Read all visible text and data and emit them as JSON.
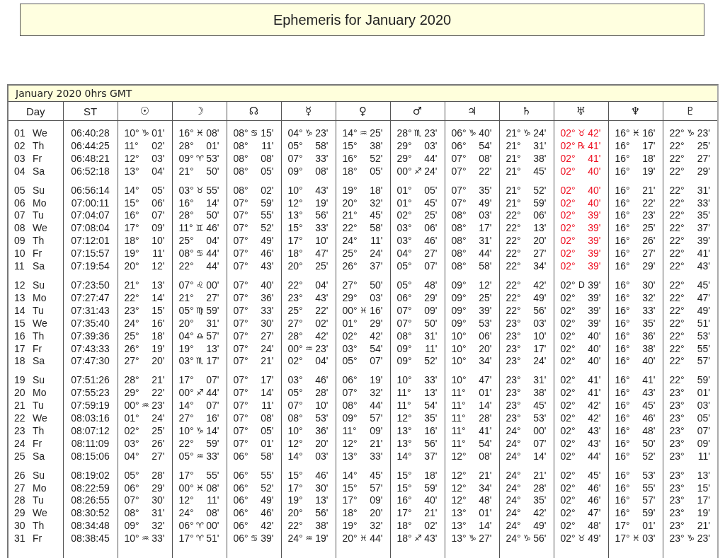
{
  "title": "Ephemeris for January 2020",
  "table": {
    "caption": "January 2020  0hrs GMT",
    "columns": [
      "Day",
      "ST",
      "☉",
      "☽",
      "☊",
      "☿",
      "♀",
      "♂",
      "♃",
      "♄",
      "♅",
      "♆",
      "♇"
    ],
    "weeks": [
      {
        "rows": [
          {
            "day": "01",
            "weekday": "We",
            "st": "06:40:28",
            "uranus_highlighted": true,
            "positions": [
              [
                "10°",
                "♑",
                "01'"
              ],
              [
                "16°",
                "♓",
                "08'"
              ],
              [
                "08°",
                "♋",
                "15'"
              ],
              [
                "04°",
                "♑",
                "23'"
              ],
              [
                "14°",
                "♒",
                "25'"
              ],
              [
                "28°",
                "♏",
                "23'"
              ],
              [
                "06°",
                "♑",
                "40'"
              ],
              [
                "21°",
                "♑",
                "24'"
              ],
              [
                "02°",
                "♉",
                "42'"
              ],
              [
                "16°",
                "♓",
                "16'"
              ],
              [
                "22°",
                "♑",
                "23'"
              ]
            ]
          },
          {
            "day": "02",
            "weekday": "Th",
            "st": "06:44:25",
            "uranus_highlighted": true,
            "positions": [
              [
                "11°",
                "02'"
              ],
              [
                "28°",
                "01'"
              ],
              [
                "08°",
                "11'"
              ],
              [
                "05°",
                "58'"
              ],
              [
                "15°",
                "38'"
              ],
              [
                "29°",
                "03'"
              ],
              [
                "06°",
                "54'"
              ],
              [
                "21°",
                "31'"
              ],
              [
                "02°",
                "℞",
                "41'"
              ],
              [
                "16°",
                "17'"
              ],
              [
                "22°",
                "25'"
              ]
            ]
          },
          {
            "day": "03",
            "weekday": "Fr",
            "st": "06:48:21",
            "uranus_highlighted": true,
            "positions": [
              [
                "12°",
                "03'"
              ],
              [
                "09°",
                "♈",
                "53'"
              ],
              [
                "08°",
                "08'"
              ],
              [
                "07°",
                "33'"
              ],
              [
                "16°",
                "52'"
              ],
              [
                "29°",
                "44'"
              ],
              [
                "07°",
                "08'"
              ],
              [
                "21°",
                "38'"
              ],
              [
                "02°",
                "41'"
              ],
              [
                "16°",
                "18'"
              ],
              [
                "22°",
                "27'"
              ]
            ]
          },
          {
            "day": "04",
            "weekday": "Sa",
            "st": "06:52:18",
            "uranus_highlighted": true,
            "positions": [
              [
                "13°",
                "04'"
              ],
              [
                "21°",
                "50'"
              ],
              [
                "08°",
                "05'"
              ],
              [
                "09°",
                "08'"
              ],
              [
                "18°",
                "05'"
              ],
              [
                "00°",
                "♐",
                "24'"
              ],
              [
                "07°",
                "22'"
              ],
              [
                "21°",
                "45'"
              ],
              [
                "02°",
                "40'"
              ],
              [
                "16°",
                "19'"
              ],
              [
                "22°",
                "29'"
              ]
            ]
          }
        ]
      },
      {
        "rows": [
          {
            "day": "05",
            "weekday": "Su",
            "st": "06:56:14",
            "uranus_highlighted": true,
            "positions": [
              [
                "14°",
                "05'"
              ],
              [
                "03°",
                "♉",
                "55'"
              ],
              [
                "08°",
                "02'"
              ],
              [
                "10°",
                "43'"
              ],
              [
                "19°",
                "18'"
              ],
              [
                "01°",
                "05'"
              ],
              [
                "07°",
                "35'"
              ],
              [
                "21°",
                "52'"
              ],
              [
                "02°",
                "40'"
              ],
              [
                "16°",
                "21'"
              ],
              [
                "22°",
                "31'"
              ]
            ]
          },
          {
            "day": "06",
            "weekday": "Mo",
            "st": "07:00:11",
            "uranus_highlighted": true,
            "positions": [
              [
                "15°",
                "06'"
              ],
              [
                "16°",
                "14'"
              ],
              [
                "07°",
                "59'"
              ],
              [
                "12°",
                "19'"
              ],
              [
                "20°",
                "32'"
              ],
              [
                "01°",
                "45'"
              ],
              [
                "07°",
                "49'"
              ],
              [
                "21°",
                "59'"
              ],
              [
                "02°",
                "40'"
              ],
              [
                "16°",
                "22'"
              ],
              [
                "22°",
                "33'"
              ]
            ]
          },
          {
            "day": "07",
            "weekday": "Tu",
            "st": "07:04:07",
            "uranus_highlighted": true,
            "positions": [
              [
                "16°",
                "07'"
              ],
              [
                "28°",
                "50'"
              ],
              [
                "07°",
                "55'"
              ],
              [
                "13°",
                "56'"
              ],
              [
                "21°",
                "45'"
              ],
              [
                "02°",
                "25'"
              ],
              [
                "08°",
                "03'"
              ],
              [
                "22°",
                "06'"
              ],
              [
                "02°",
                "39'"
              ],
              [
                "16°",
                "23'"
              ],
              [
                "22°",
                "35'"
              ]
            ]
          },
          {
            "day": "08",
            "weekday": "We",
            "st": "07:08:04",
            "uranus_highlighted": true,
            "positions": [
              [
                "17°",
                "09'"
              ],
              [
                "11°",
                "♊",
                "46'"
              ],
              [
                "07°",
                "52'"
              ],
              [
                "15°",
                "33'"
              ],
              [
                "22°",
                "58'"
              ],
              [
                "03°",
                "06'"
              ],
              [
                "08°",
                "17'"
              ],
              [
                "22°",
                "13'"
              ],
              [
                "02°",
                "39'"
              ],
              [
                "16°",
                "25'"
              ],
              [
                "22°",
                "37'"
              ]
            ]
          },
          {
            "day": "09",
            "weekday": "Th",
            "st": "07:12:01",
            "uranus_highlighted": true,
            "positions": [
              [
                "18°",
                "10'"
              ],
              [
                "25°",
                "04'"
              ],
              [
                "07°",
                "49'"
              ],
              [
                "17°",
                "10'"
              ],
              [
                "24°",
                "11'"
              ],
              [
                "03°",
                "46'"
              ],
              [
                "08°",
                "31'"
              ],
              [
                "22°",
                "20'"
              ],
              [
                "02°",
                "39'"
              ],
              [
                "16°",
                "26'"
              ],
              [
                "22°",
                "39'"
              ]
            ]
          },
          {
            "day": "10",
            "weekday": "Fr",
            "st": "07:15:57",
            "uranus_highlighted": true,
            "positions": [
              [
                "19°",
                "11'"
              ],
              [
                "08°",
                "♋",
                "44'"
              ],
              [
                "07°",
                "46'"
              ],
              [
                "18°",
                "47'"
              ],
              [
                "25°",
                "24'"
              ],
              [
                "04°",
                "27'"
              ],
              [
                "08°",
                "44'"
              ],
              [
                "22°",
                "27'"
              ],
              [
                "02°",
                "39'"
              ],
              [
                "16°",
                "27'"
              ],
              [
                "22°",
                "41'"
              ]
            ]
          },
          {
            "day": "11",
            "weekday": "Sa",
            "st": "07:19:54",
            "uranus_highlighted": true,
            "positions": [
              [
                "20°",
                "12'"
              ],
              [
                "22°",
                "44'"
              ],
              [
                "07°",
                "43'"
              ],
              [
                "20°",
                "25'"
              ],
              [
                "26°",
                "37'"
              ],
              [
                "05°",
                "07'"
              ],
              [
                "08°",
                "58'"
              ],
              [
                "22°",
                "34'"
              ],
              [
                "02°",
                "39'"
              ],
              [
                "16°",
                "29'"
              ],
              [
                "22°",
                "43'"
              ]
            ]
          }
        ]
      },
      {
        "rows": [
          {
            "day": "12",
            "weekday": "Su",
            "st": "07:23:50",
            "uranus_highlighted": false,
            "positions": [
              [
                "21°",
                "13'"
              ],
              [
                "07°",
                "♌",
                "00'"
              ],
              [
                "07°",
                "40'"
              ],
              [
                "22°",
                "04'"
              ],
              [
                "27°",
                "50'"
              ],
              [
                "05°",
                "48'"
              ],
              [
                "09°",
                "12'"
              ],
              [
                "22°",
                "42'"
              ],
              [
                "02°",
                "D",
                "39'"
              ],
              [
                "16°",
                "30'"
              ],
              [
                "22°",
                "45'"
              ]
            ]
          },
          {
            "day": "13",
            "weekday": "Mo",
            "st": "07:27:47",
            "uranus_highlighted": false,
            "positions": [
              [
                "22°",
                "14'"
              ],
              [
                "21°",
                "27'"
              ],
              [
                "07°",
                "36'"
              ],
              [
                "23°",
                "43'"
              ],
              [
                "29°",
                "03'"
              ],
              [
                "06°",
                "29'"
              ],
              [
                "09°",
                "25'"
              ],
              [
                "22°",
                "49'"
              ],
              [
                "02°",
                "39'"
              ],
              [
                "16°",
                "32'"
              ],
              [
                "22°",
                "47'"
              ]
            ]
          },
          {
            "day": "14",
            "weekday": "Tu",
            "st": "07:31:43",
            "uranus_highlighted": false,
            "positions": [
              [
                "23°",
                "15'"
              ],
              [
                "05°",
                "♍",
                "59'"
              ],
              [
                "07°",
                "33'"
              ],
              [
                "25°",
                "22'"
              ],
              [
                "00°",
                "♓",
                "16'"
              ],
              [
                "07°",
                "09'"
              ],
              [
                "09°",
                "39'"
              ],
              [
                "22°",
                "56'"
              ],
              [
                "02°",
                "39'"
              ],
              [
                "16°",
                "33'"
              ],
              [
                "22°",
                "49'"
              ]
            ]
          },
          {
            "day": "15",
            "weekday": "We",
            "st": "07:35:40",
            "uranus_highlighted": false,
            "positions": [
              [
                "24°",
                "16'"
              ],
              [
                "20°",
                "31'"
              ],
              [
                "07°",
                "30'"
              ],
              [
                "27°",
                "02'"
              ],
              [
                "01°",
                "29'"
              ],
              [
                "07°",
                "50'"
              ],
              [
                "09°",
                "53'"
              ],
              [
                "23°",
                "03'"
              ],
              [
                "02°",
                "39'"
              ],
              [
                "16°",
                "35'"
              ],
              [
                "22°",
                "51'"
              ]
            ]
          },
          {
            "day": "16",
            "weekday": "Th",
            "st": "07:39:36",
            "uranus_highlighted": false,
            "positions": [
              [
                "25°",
                "18'"
              ],
              [
                "04°",
                "♎",
                "57'"
              ],
              [
                "07°",
                "27'"
              ],
              [
                "28°",
                "42'"
              ],
              [
                "02°",
                "42'"
              ],
              [
                "08°",
                "31'"
              ],
              [
                "10°",
                "06'"
              ],
              [
                "23°",
                "10'"
              ],
              [
                "02°",
                "40'"
              ],
              [
                "16°",
                "36'"
              ],
              [
                "22°",
                "53'"
              ]
            ]
          },
          {
            "day": "17",
            "weekday": "Fr",
            "st": "07:43:33",
            "uranus_highlighted": false,
            "positions": [
              [
                "26°",
                "19'"
              ],
              [
                "19°",
                "13'"
              ],
              [
                "07°",
                "24'"
              ],
              [
                "00°",
                "♒",
                "23'"
              ],
              [
                "03°",
                "54'"
              ],
              [
                "09°",
                "11'"
              ],
              [
                "10°",
                "20'"
              ],
              [
                "23°",
                "17'"
              ],
              [
                "02°",
                "40'"
              ],
              [
                "16°",
                "38'"
              ],
              [
                "22°",
                "55'"
              ]
            ]
          },
          {
            "day": "18",
            "weekday": "Sa",
            "st": "07:47:30",
            "uranus_highlighted": false,
            "positions": [
              [
                "27°",
                "20'"
              ],
              [
                "03°",
                "♏",
                "17'"
              ],
              [
                "07°",
                "21'"
              ],
              [
                "02°",
                "04'"
              ],
              [
                "05°",
                "07'"
              ],
              [
                "09°",
                "52'"
              ],
              [
                "10°",
                "34'"
              ],
              [
                "23°",
                "24'"
              ],
              [
                "02°",
                "40'"
              ],
              [
                "16°",
                "40'"
              ],
              [
                "22°",
                "57'"
              ]
            ]
          }
        ]
      },
      {
        "rows": [
          {
            "day": "19",
            "weekday": "Su",
            "st": "07:51:26",
            "uranus_highlighted": false,
            "positions": [
              [
                "28°",
                "21'"
              ],
              [
                "17°",
                "07'"
              ],
              [
                "07°",
                "17'"
              ],
              [
                "03°",
                "46'"
              ],
              [
                "06°",
                "19'"
              ],
              [
                "10°",
                "33'"
              ],
              [
                "10°",
                "47'"
              ],
              [
                "23°",
                "31'"
              ],
              [
                "02°",
                "41'"
              ],
              [
                "16°",
                "41'"
              ],
              [
                "22°",
                "59'"
              ]
            ]
          },
          {
            "day": "20",
            "weekday": "Mo",
            "st": "07:55:23",
            "uranus_highlighted": false,
            "positions": [
              [
                "29°",
                "22'"
              ],
              [
                "00°",
                "♐",
                "44'"
              ],
              [
                "07°",
                "14'"
              ],
              [
                "05°",
                "28'"
              ],
              [
                "07°",
                "32'"
              ],
              [
                "11°",
                "13'"
              ],
              [
                "11°",
                "01'"
              ],
              [
                "23°",
                "38'"
              ],
              [
                "02°",
                "41'"
              ],
              [
                "16°",
                "43'"
              ],
              [
                "23°",
                "01'"
              ]
            ]
          },
          {
            "day": "21",
            "weekday": "Tu",
            "st": "07:59:19",
            "uranus_highlighted": false,
            "positions": [
              [
                "00°",
                "♒",
                "23'"
              ],
              [
                "14°",
                "07'"
              ],
              [
                "07°",
                "11'"
              ],
              [
                "07°",
                "10'"
              ],
              [
                "08°",
                "44'"
              ],
              [
                "11°",
                "54'"
              ],
              [
                "11°",
                "14'"
              ],
              [
                "23°",
                "45'"
              ],
              [
                "02°",
                "42'"
              ],
              [
                "16°",
                "45'"
              ],
              [
                "23°",
                "03'"
              ]
            ]
          },
          {
            "day": "22",
            "weekday": "We",
            "st": "08:03:16",
            "uranus_highlighted": false,
            "positions": [
              [
                "01°",
                "24'"
              ],
              [
                "27°",
                "16'"
              ],
              [
                "07°",
                "08'"
              ],
              [
                "08°",
                "53'"
              ],
              [
                "09°",
                "57'"
              ],
              [
                "12°",
                "35'"
              ],
              [
                "11°",
                "28'"
              ],
              [
                "23°",
                "53'"
              ],
              [
                "02°",
                "42'"
              ],
              [
                "16°",
                "46'"
              ],
              [
                "23°",
                "05'"
              ]
            ]
          },
          {
            "day": "23",
            "weekday": "Th",
            "st": "08:07:12",
            "uranus_highlighted": false,
            "positions": [
              [
                "02°",
                "25'"
              ],
              [
                "10°",
                "♑",
                "14'"
              ],
              [
                "07°",
                "05'"
              ],
              [
                "10°",
                "36'"
              ],
              [
                "11°",
                "09'"
              ],
              [
                "13°",
                "16'"
              ],
              [
                "11°",
                "41'"
              ],
              [
                "24°",
                "00'"
              ],
              [
                "02°",
                "43'"
              ],
              [
                "16°",
                "48'"
              ],
              [
                "23°",
                "07'"
              ]
            ]
          },
          {
            "day": "24",
            "weekday": "Fr",
            "st": "08:11:09",
            "uranus_highlighted": false,
            "positions": [
              [
                "03°",
                "26'"
              ],
              [
                "22°",
                "59'"
              ],
              [
                "07°",
                "01'"
              ],
              [
                "12°",
                "20'"
              ],
              [
                "12°",
                "21'"
              ],
              [
                "13°",
                "56'"
              ],
              [
                "11°",
                "54'"
              ],
              [
                "24°",
                "07'"
              ],
              [
                "02°",
                "43'"
              ],
              [
                "16°",
                "50'"
              ],
              [
                "23°",
                "09'"
              ]
            ]
          },
          {
            "day": "25",
            "weekday": "Sa",
            "st": "08:15:06",
            "uranus_highlighted": false,
            "positions": [
              [
                "04°",
                "27'"
              ],
              [
                "05°",
                "♒",
                "33'"
              ],
              [
                "06°",
                "58'"
              ],
              [
                "14°",
                "03'"
              ],
              [
                "13°",
                "33'"
              ],
              [
                "14°",
                "37'"
              ],
              [
                "12°",
                "08'"
              ],
              [
                "24°",
                "14'"
              ],
              [
                "02°",
                "44'"
              ],
              [
                "16°",
                "52'"
              ],
              [
                "23°",
                "11'"
              ]
            ]
          }
        ]
      },
      {
        "rows": [
          {
            "day": "26",
            "weekday": "Su",
            "st": "08:19:02",
            "uranus_highlighted": false,
            "positions": [
              [
                "05°",
                "28'"
              ],
              [
                "17°",
                "55'"
              ],
              [
                "06°",
                "55'"
              ],
              [
                "15°",
                "46'"
              ],
              [
                "14°",
                "45'"
              ],
              [
                "15°",
                "18'"
              ],
              [
                "12°",
                "21'"
              ],
              [
                "24°",
                "21'"
              ],
              [
                "02°",
                "45'"
              ],
              [
                "16°",
                "53'"
              ],
              [
                "23°",
                "13'"
              ]
            ]
          },
          {
            "day": "27",
            "weekday": "Mo",
            "st": "08:22:59",
            "uranus_highlighted": false,
            "positions": [
              [
                "06°",
                "29'"
              ],
              [
                "00°",
                "♓",
                "08'"
              ],
              [
                "06°",
                "52'"
              ],
              [
                "17°",
                "30'"
              ],
              [
                "15°",
                "57'"
              ],
              [
                "15°",
                "59'"
              ],
              [
                "12°",
                "34'"
              ],
              [
                "24°",
                "28'"
              ],
              [
                "02°",
                "46'"
              ],
              [
                "16°",
                "55'"
              ],
              [
                "23°",
                "15'"
              ]
            ]
          },
          {
            "day": "28",
            "weekday": "Tu",
            "st": "08:26:55",
            "uranus_highlighted": false,
            "positions": [
              [
                "07°",
                "30'"
              ],
              [
                "12°",
                "11'"
              ],
              [
                "06°",
                "49'"
              ],
              [
                "19°",
                "13'"
              ],
              [
                "17°",
                "09'"
              ],
              [
                "16°",
                "40'"
              ],
              [
                "12°",
                "48'"
              ],
              [
                "24°",
                "35'"
              ],
              [
                "02°",
                "46'"
              ],
              [
                "16°",
                "57'"
              ],
              [
                "23°",
                "17'"
              ]
            ]
          },
          {
            "day": "29",
            "weekday": "We",
            "st": "08:30:52",
            "uranus_highlighted": false,
            "positions": [
              [
                "08°",
                "31'"
              ],
              [
                "24°",
                "08'"
              ],
              [
                "06°",
                "46'"
              ],
              [
                "20°",
                "56'"
              ],
              [
                "18°",
                "20'"
              ],
              [
                "17°",
                "21'"
              ],
              [
                "13°",
                "01'"
              ],
              [
                "24°",
                "42'"
              ],
              [
                "02°",
                "47'"
              ],
              [
                "16°",
                "59'"
              ],
              [
                "23°",
                "19'"
              ]
            ]
          },
          {
            "day": "30",
            "weekday": "Th",
            "st": "08:34:48",
            "uranus_highlighted": false,
            "positions": [
              [
                "09°",
                "32'"
              ],
              [
                "06°",
                "♈",
                "00'"
              ],
              [
                "06°",
                "42'"
              ],
              [
                "22°",
                "38'"
              ],
              [
                "19°",
                "32'"
              ],
              [
                "18°",
                "02'"
              ],
              [
                "13°",
                "14'"
              ],
              [
                "24°",
                "49'"
              ],
              [
                "02°",
                "48'"
              ],
              [
                "17°",
                "01'"
              ],
              [
                "23°",
                "21'"
              ]
            ]
          },
          {
            "day": "31",
            "weekday": "Fr",
            "st": "08:38:45",
            "uranus_highlighted": false,
            "positions": [
              [
                "10°",
                "♒",
                "33'"
              ],
              [
                "17°",
                "♈",
                "51'"
              ],
              [
                "06°",
                "♋",
                "39'"
              ],
              [
                "24°",
                "♒",
                "19'"
              ],
              [
                "20°",
                "♓",
                "44'"
              ],
              [
                "18°",
                "♐",
                "43'"
              ],
              [
                "13°",
                "♑",
                "27'"
              ],
              [
                "24°",
                "♑",
                "56'"
              ],
              [
                "02°",
                "♉",
                "49'"
              ],
              [
                "17°",
                "♓",
                "03'"
              ],
              [
                "23°",
                "♑",
                "23'"
              ]
            ]
          }
        ]
      }
    ]
  }
}
